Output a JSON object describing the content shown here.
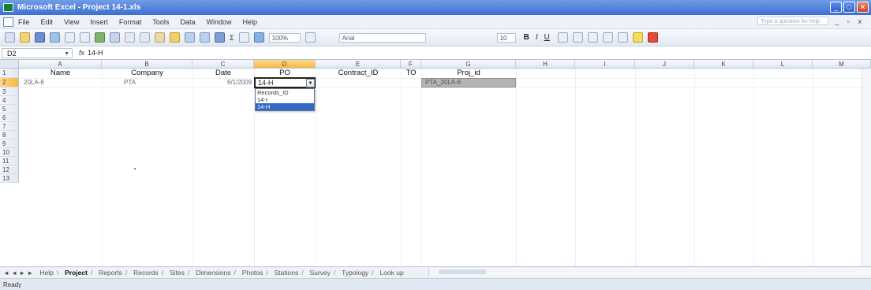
{
  "window": {
    "title": "Microsoft Excel - Project 14-1.xls",
    "buttons": [
      "_",
      "□",
      "✕"
    ]
  },
  "menu": {
    "items": [
      "File",
      "Edit",
      "View",
      "Insert",
      "Format",
      "Tools",
      "Data",
      "Window",
      "Help"
    ],
    "help_placeholder": "Type a question for help",
    "mdi_controls": "_ ▫ x"
  },
  "toolbar": {
    "zoom": "100%",
    "font_name": "Arial",
    "font_size": "10",
    "bold": "B",
    "italic": "I",
    "underline": "U",
    "sum": "Σ"
  },
  "formula_bar": {
    "name_box": "D2",
    "fx": "fx",
    "value": "14-H"
  },
  "grid": {
    "columns": [
      "A",
      "B",
      "C",
      "D",
      "E",
      "F",
      "G",
      "H",
      "I",
      "J",
      "K",
      "L",
      "M"
    ],
    "rows": [
      "1",
      "2",
      "3",
      "4",
      "5",
      "6",
      "7",
      "8",
      "9",
      "10",
      "11",
      "12",
      "13"
    ],
    "headers": {
      "name": "Name",
      "company": "Company",
      "date": "Date",
      "po": "PO",
      "contract_id": "Contract_ID",
      "to": "TO",
      "proj_id": "Proj_id"
    },
    "row2": {
      "name": "20LA-6",
      "company": "PTA",
      "date": "6/1/2009",
      "po": "14-H",
      "proj_id": "PTA_20LA-6"
    },
    "dropdown_options": [
      "Records_ID",
      "14-I",
      "14-H"
    ],
    "dropdown_selected": "14-H"
  },
  "sheet_tabs": {
    "nav": "◄ ◄ ► ►",
    "tabs": [
      "Help",
      "Project",
      "Reports",
      "Records",
      "Sites",
      "Dimensions",
      "Photos",
      "Stations",
      "Survey",
      "Typology",
      "Look up"
    ],
    "active": "Project"
  },
  "status": {
    "text": "Ready"
  },
  "colors": {
    "title_bar": "#3f6fd0",
    "selected_header": "#f4b942",
    "dropdown_highlight": "#3169c6",
    "proj_cell_fill": "#b4b4b4"
  }
}
